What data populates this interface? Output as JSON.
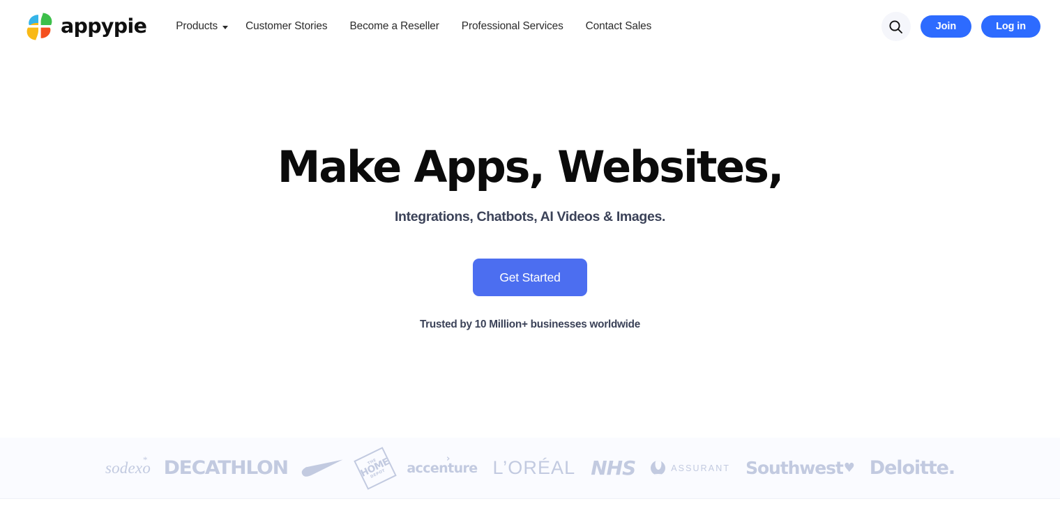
{
  "header": {
    "brand": {
      "name": "appypie",
      "icon": "appypie-pinwheel-logo"
    },
    "nav": [
      {
        "label": "Products",
        "caret": true
      },
      {
        "label": "Customer Stories",
        "caret": false
      },
      {
        "label": "Become a Reseller",
        "caret": false
      },
      {
        "label": "Professional Services",
        "caret": false
      },
      {
        "label": "Contact Sales",
        "caret": false
      }
    ],
    "search": {
      "icon": "search-icon"
    },
    "join_label": "Join",
    "login_label": "Log in"
  },
  "hero": {
    "title": "Make Apps, Websites,",
    "subtitle": "Integrations, Chatbots, AI Videos & Images.",
    "cta_label": "Get Started",
    "trust_text": "Trusted by 10 Million+ businesses worldwide"
  },
  "logos": {
    "sodexo": "sodexo",
    "sodexo_star": "*",
    "decathlon": "DECATHLON",
    "nike": "nike-swoosh-logo",
    "homedepot_the": "THE",
    "homedepot_home": "HOME",
    "homedepot_depot": "DEPOT",
    "accenture": "accenture",
    "accenture_arrow": "›",
    "loreal": "L’ORÉAL",
    "nhs": "NHS",
    "assurant": "ASSURANT",
    "southwest": "Southwest",
    "southwest_heart": "♥",
    "deloitte": "Deloitte."
  },
  "colors": {
    "brand_blue": "#2d6bff",
    "cta_blue": "#4c6ef0",
    "logo_grey": "#c2cae0",
    "strip_bg": "#fafbff",
    "heading": "#0b0b0b",
    "subtext": "#3b4258"
  }
}
